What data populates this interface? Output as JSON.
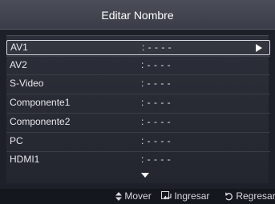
{
  "title": "Editar Nombre",
  "rows": [
    {
      "label": "AV1",
      "value": ": - - - -"
    },
    {
      "label": "AV2",
      "value": ": - - - -"
    },
    {
      "label": "S-Video",
      "value": ": - - - -"
    },
    {
      "label": "Componente1",
      "value": ": - - - -"
    },
    {
      "label": "Componente2",
      "value": ": - - - -"
    },
    {
      "label": "PC",
      "value": ": - - - -"
    },
    {
      "label": "HDMI1",
      "value": ": - - - -"
    }
  ],
  "footer": {
    "move_label": "Mover",
    "enter_label": "Ingresar",
    "return_label": "Regresar"
  },
  "icons": {
    "selected_row_arrow": "play-right-icon",
    "more_below": "scroll-down-icon",
    "move": "up-down-arrows-icon",
    "enter": "enter-icon",
    "return": "return-icon"
  }
}
